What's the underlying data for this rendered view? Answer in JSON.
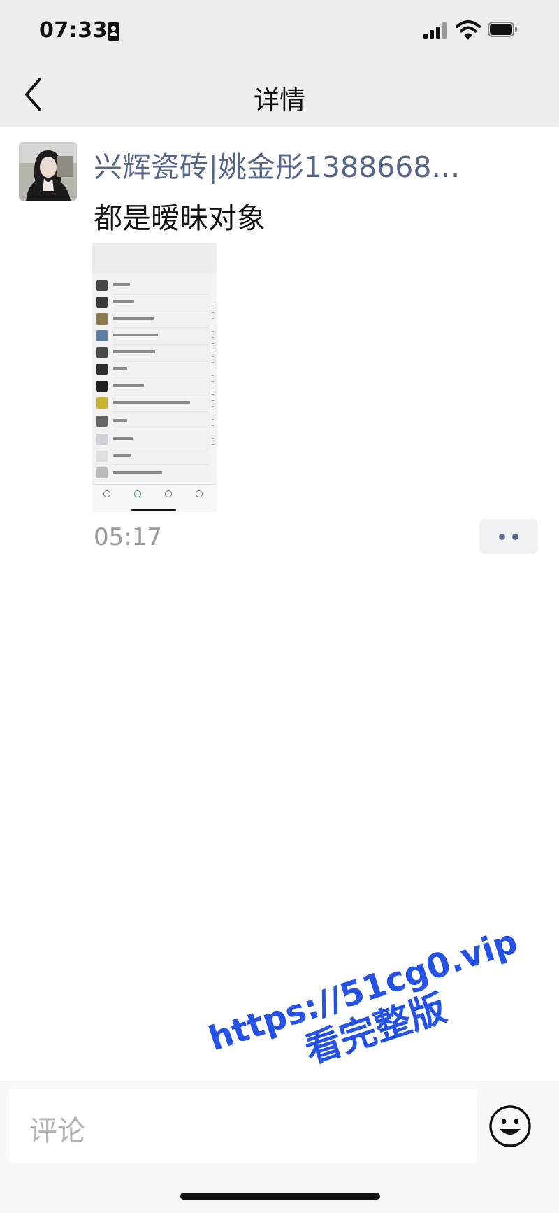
{
  "status_bar": {
    "time": "07:33"
  },
  "nav": {
    "title": "详情",
    "back_icon": "chevron-left-icon"
  },
  "post": {
    "username": "兴辉瓷砖|姚金彤1388668…",
    "text": "都是暧昧对象",
    "time": "05:17",
    "more_icon": "more-dots-icon"
  },
  "watermark": {
    "url": "https://51cg0.vip",
    "subtitle": "看完整版"
  },
  "comment": {
    "placeholder": "评论",
    "emoji_icon": "emoji-icon"
  },
  "colors": {
    "username": "#56668a",
    "watermark": "#2452e6",
    "nav_background": "#ededed"
  }
}
